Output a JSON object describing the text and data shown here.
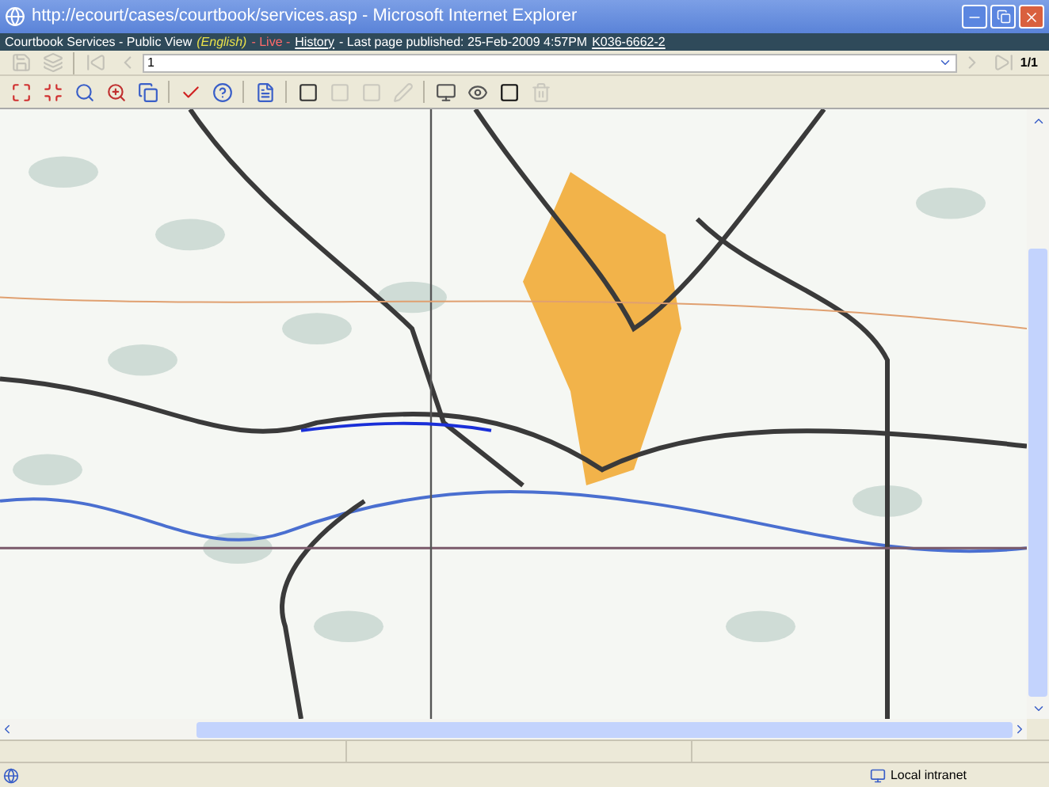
{
  "window": {
    "title": "http://ecourt/cases/courtbook/services.asp - Microsoft Internet Explorer"
  },
  "info_bar": {
    "prefix": "Courtbook Services - Public View",
    "language": "(English)",
    "live": "- Live -",
    "history": "History",
    "published": "- Last page published: 25-Feb-2009  4:57PM",
    "case_number": "K036-6662-2"
  },
  "page_toolbar": {
    "page_field": "1",
    "page_count": "1/1"
  },
  "status_bar": {
    "zone": "Local intranet"
  }
}
